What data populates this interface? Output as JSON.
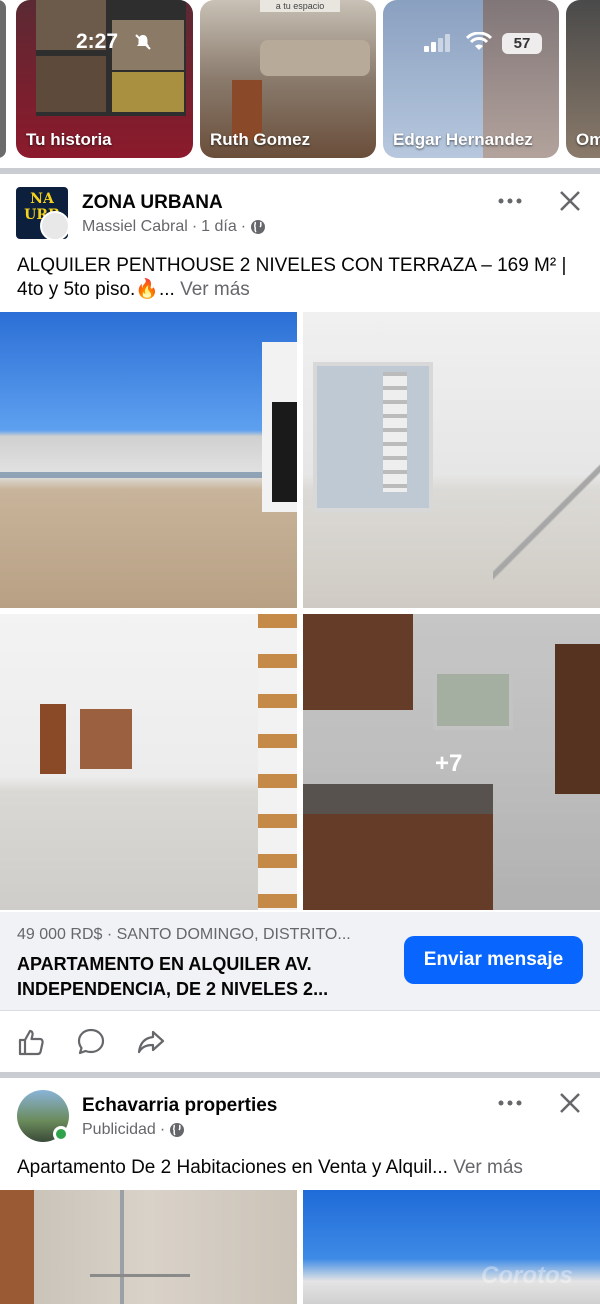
{
  "status_bar": {
    "time": "2:27",
    "battery": "57"
  },
  "stories": [
    {
      "label": "Tu historia"
    },
    {
      "label": "Ruth Gomez",
      "overlay_text": "a tu espacio"
    },
    {
      "label": "Edgar Hernandez"
    },
    {
      "label": "Om"
    }
  ],
  "post1": {
    "page_name": "ZONA URBANA",
    "avatar_text": "NA URB",
    "author": "Massiel Cabral",
    "time": "1 día",
    "text": "ALQUILER PENTHOUSE 2 NIVELES CON TERRAZA – 169 M² | 4to y 5to piso.🔥...",
    "see_more": "Ver más",
    "more_photos": "+7",
    "listing": {
      "price_location": "49 000 RD$ · SANTO DOMINGO, DISTRITO...",
      "title": "APARTAMENTO EN ALQUILER AV. INDEPENDENCIA,  DE 2 NIVELES 2...",
      "button": "Enviar mensaje"
    }
  },
  "post2": {
    "page_name": "Echavarria properties",
    "meta": "Publicidad",
    "text": "Apartamento De 2 Habitaciones en Venta y Alquil...",
    "see_more": "Ver más",
    "watermark": "Corotos"
  },
  "colors": {
    "accent": "#0866ff",
    "muted": "#65676b",
    "separator": "#c9ccd1",
    "online": "#31a24c"
  }
}
